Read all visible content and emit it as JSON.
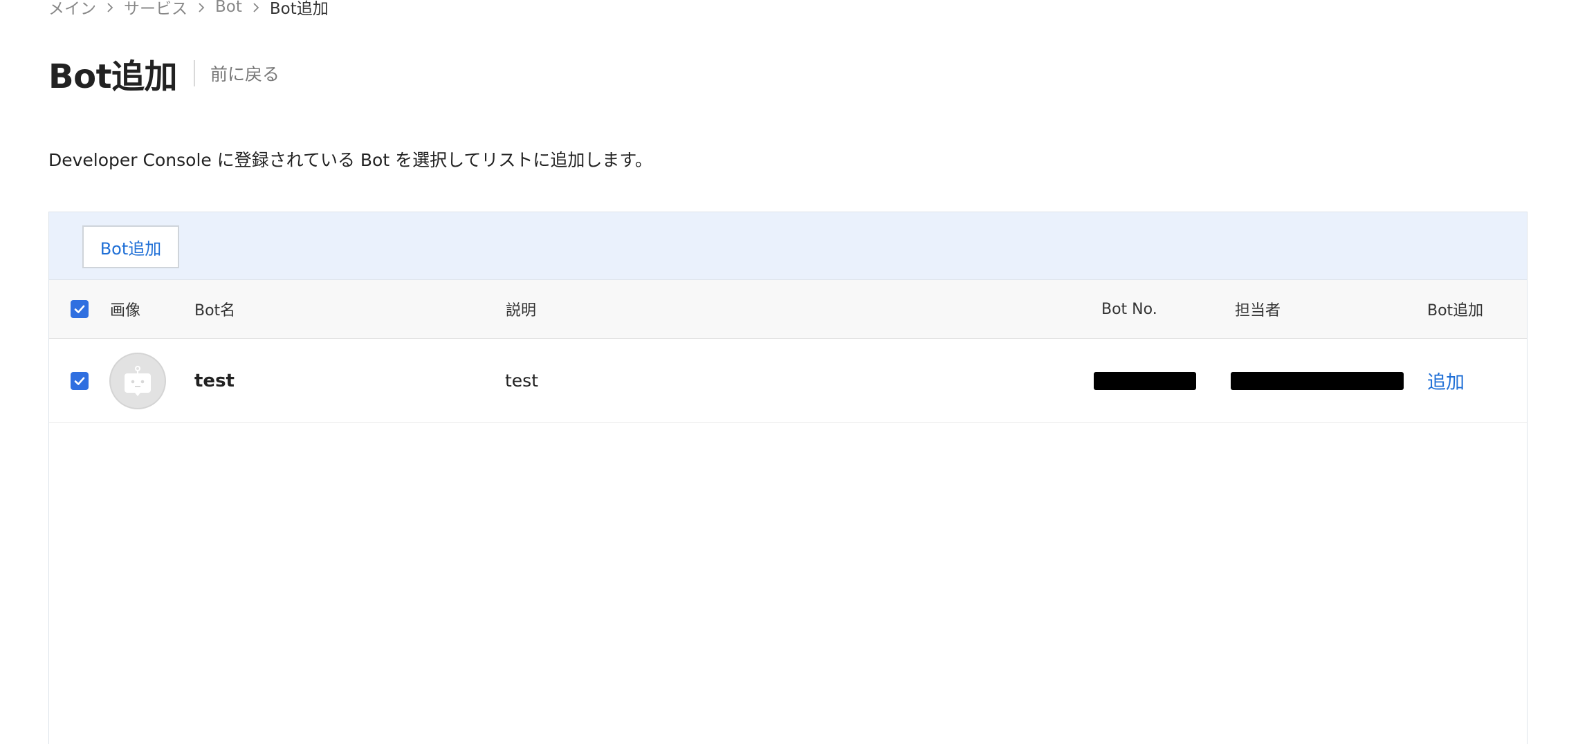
{
  "breadcrumb": {
    "items": [
      {
        "label": "メイン"
      },
      {
        "label": "サービス"
      },
      {
        "label": "Bot"
      },
      {
        "label": "Bot追加"
      }
    ]
  },
  "header": {
    "title": "Bot追加",
    "back_label": "前に戻る"
  },
  "description": "Developer Console に登録されている Bot を選択してリストに追加します。",
  "toolbar": {
    "add_button_label": "Bot追加"
  },
  "table": {
    "columns": {
      "image": "画像",
      "name": "Bot名",
      "description": "説明",
      "bot_no": "Bot No.",
      "owner": "担当者",
      "add": "Bot追加"
    },
    "header_checkbox_checked": true,
    "rows": [
      {
        "checked": true,
        "avatar_icon": "bot-avatar-icon",
        "name": "test",
        "description": "test",
        "bot_no": "[redacted]",
        "owner": "[redacted]",
        "add_label": "追加"
      }
    ]
  },
  "colors": {
    "accent": "#1f6fd6",
    "checkbox": "#2f6fe0",
    "toolbar_bg": "#eaf1fc",
    "header_bg": "#f8f8f8"
  }
}
